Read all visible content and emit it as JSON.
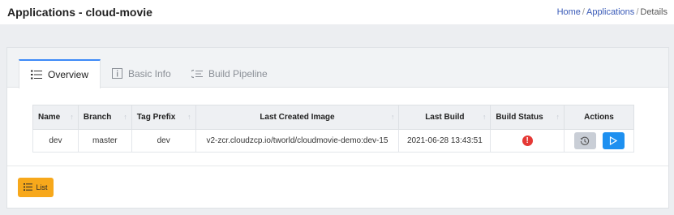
{
  "header": {
    "title": "Applications - cloud-movie",
    "breadcrumb": [
      "Home",
      "Applications",
      "Details"
    ]
  },
  "tabs": [
    {
      "label": "Overview",
      "icon": "list-icon",
      "active": true
    },
    {
      "label": "Basic Info",
      "icon": "info-icon",
      "active": false
    },
    {
      "label": "Build Pipeline",
      "icon": "pipeline-icon",
      "active": false
    }
  ],
  "table": {
    "columns": [
      "Name",
      "Branch",
      "Tag Prefix",
      "Last Created Image",
      "Last Build",
      "Build Status",
      "Actions"
    ],
    "rows": [
      {
        "name": "dev",
        "branch": "master",
        "tag_prefix": "dev",
        "last_created_image": "v2-zcr.cloudzcp.io/tworld/cloudmovie-demo:dev-15",
        "last_build": "2021-06-28 13:43:51",
        "build_status": "error",
        "build_status_symbol": "!"
      }
    ]
  },
  "footer": {
    "list_button": "List"
  },
  "colors": {
    "accent": "#3d8af7",
    "run_button": "#1e90f0",
    "error": "#e53935",
    "list_button": "#f7a81b"
  }
}
